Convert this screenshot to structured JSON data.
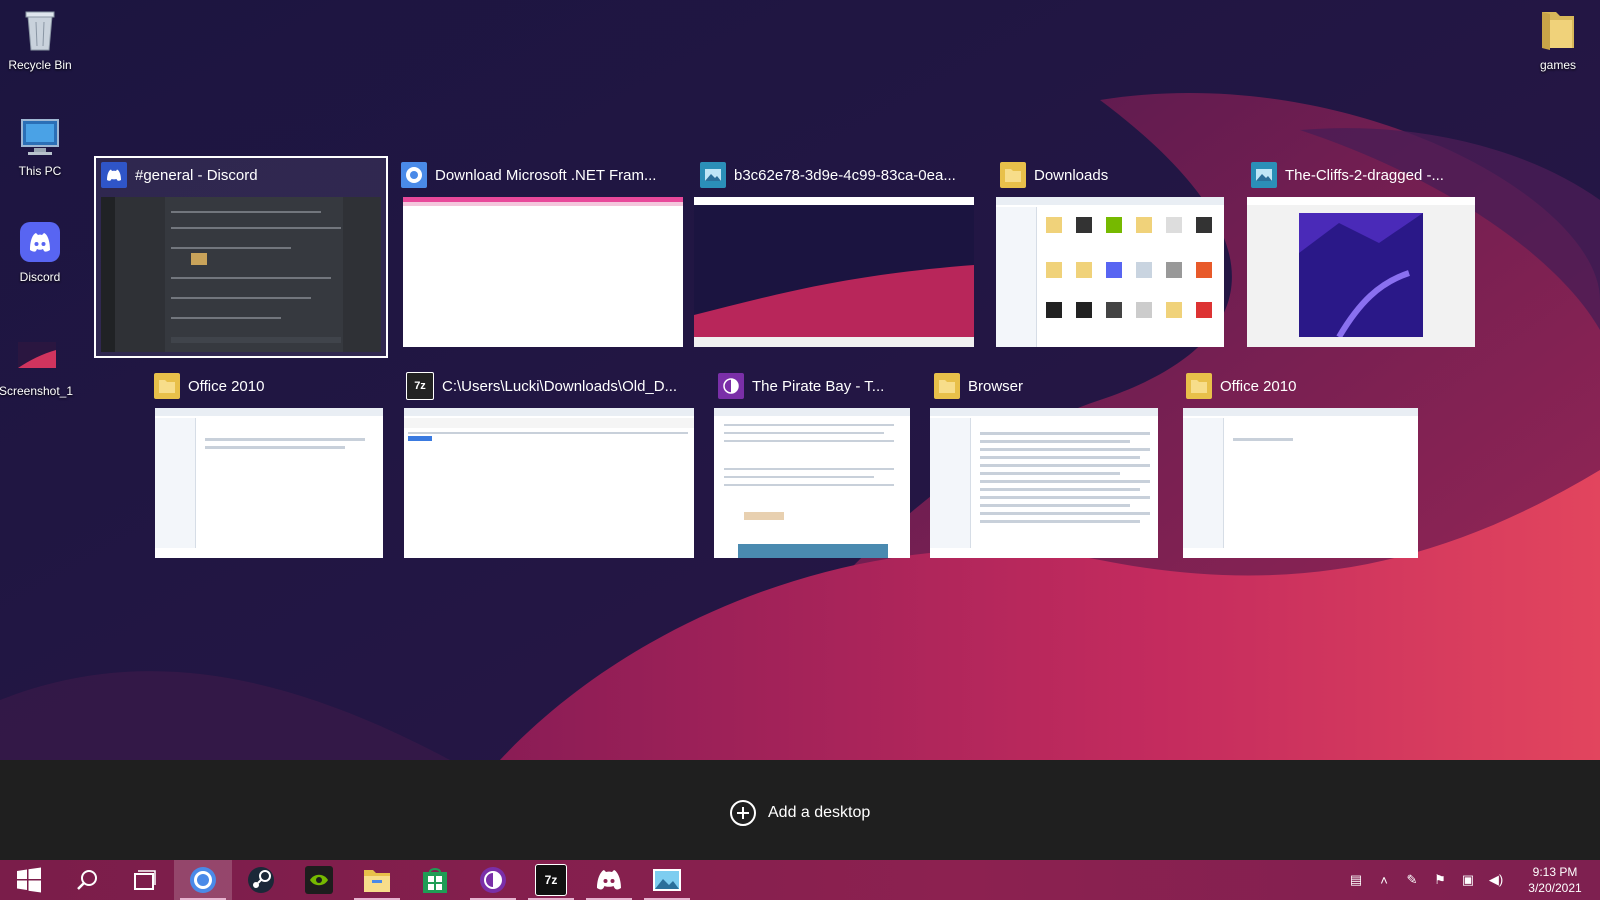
{
  "desktop": {
    "icons": [
      {
        "label": "Recycle Bin",
        "icon": "recycle-bin-icon"
      },
      {
        "label": "This PC",
        "icon": "computer-icon"
      },
      {
        "label": "Discord",
        "icon": "discord-icon"
      },
      {
        "label": "Screenshot_1",
        "icon": "image-file-icon"
      },
      {
        "label": "games",
        "icon": "folder-icon"
      }
    ]
  },
  "task_view": {
    "windows": [
      {
        "title": "#general - Discord",
        "icon": "discord-icon",
        "icon_color": "#2f55c8",
        "selected": true
      },
      {
        "title": "Download Microsoft .NET Fram...",
        "icon": "chrome-icon",
        "icon_color": "#4a8ae8"
      },
      {
        "title": "b3c62e78-3d9e-4c99-83ca-0ea...",
        "icon": "photos-icon",
        "icon_color": "#2b8fb8"
      },
      {
        "title": "Downloads",
        "icon": "folder-icon",
        "icon_color": "#e8c04a"
      },
      {
        "title": "The-Cliffs-2-dragged -...",
        "icon": "photos-icon",
        "icon_color": "#2b8fb8"
      },
      {
        "title": "Office 2010",
        "icon": "folder-icon",
        "icon_color": "#e8c04a"
      },
      {
        "title": "C:\\Users\\Lucki\\Downloads\\Old_D...",
        "icon": "7zip-icon",
        "icon_color": "#222222",
        "icon_text": "7z"
      },
      {
        "title": "The Pirate Bay - T...",
        "icon": "tor-browser-icon",
        "icon_color": "#7a2fa8"
      },
      {
        "title": "Browser",
        "icon": "folder-icon",
        "icon_color": "#e8c04a"
      },
      {
        "title": "Office 2010",
        "icon": "folder-icon",
        "icon_color": "#e8c04a"
      }
    ],
    "add_desktop_label": "Add a desktop"
  },
  "taskbar": {
    "apps": [
      {
        "name": "start-button",
        "icon": "windows-logo-icon"
      },
      {
        "name": "search-button",
        "icon": "search-icon"
      },
      {
        "name": "task-view-button",
        "icon": "task-view-icon"
      },
      {
        "name": "chrome",
        "icon": "chrome-icon"
      },
      {
        "name": "steam",
        "icon": "steam-icon"
      },
      {
        "name": "geforce-experience",
        "icon": "nvidia-icon"
      },
      {
        "name": "file-explorer",
        "icon": "folder-icon"
      },
      {
        "name": "microsoft-store",
        "icon": "store-icon"
      },
      {
        "name": "tor-browser",
        "icon": "tor-browser-icon"
      },
      {
        "name": "7zip",
        "icon": "7zip-icon",
        "icon_text": "7z"
      },
      {
        "name": "discord",
        "icon": "discord-icon"
      },
      {
        "name": "photos",
        "icon": "photos-icon"
      }
    ],
    "tray": {
      "time": "9:13 PM",
      "date": "3/20/2021"
    }
  }
}
